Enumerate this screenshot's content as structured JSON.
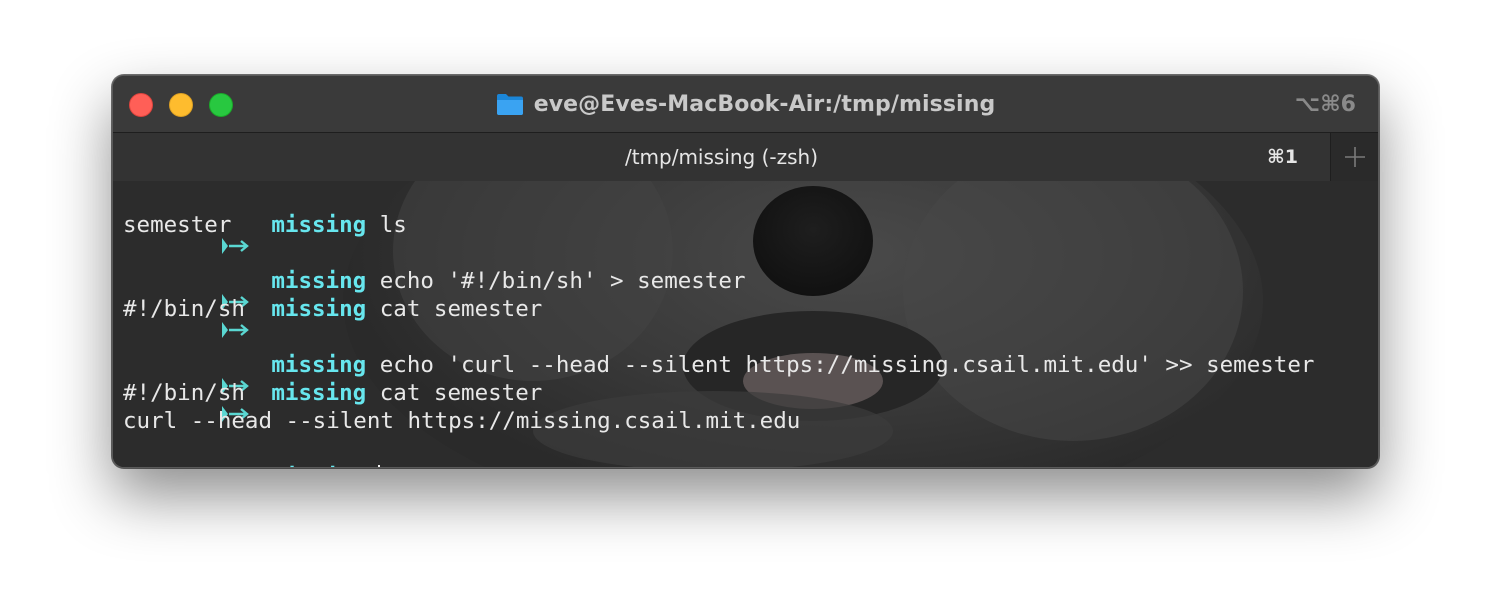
{
  "window": {
    "title": "eve@Eves-MacBook-Air:/tmp/missing",
    "title_shortcut": "⌥⌘6",
    "folder_icon": "folder-icon",
    "colors": {
      "close": "#ff5f57",
      "minimize": "#febc2e",
      "zoom": "#28c840"
    }
  },
  "tab": {
    "label": "/tmp/missing (-zsh)",
    "shortcut": "⌘1",
    "new_tab_icon": "plus-icon"
  },
  "terminal": {
    "colors": {
      "prompt_arrow": "#5ad7d2",
      "prompt_dir": "#67e6ee",
      "text": "#e8e8e8"
    },
    "lines": [
      {
        "type": "prompt",
        "dir": "missing",
        "command": "ls"
      },
      {
        "type": "output",
        "text": "semester"
      },
      {
        "type": "prompt",
        "dir": "missing",
        "command": "echo '#!/bin/sh' > semester"
      },
      {
        "type": "prompt",
        "dir": "missing",
        "command": "cat semester"
      },
      {
        "type": "output",
        "text": "#!/bin/sh"
      },
      {
        "type": "prompt",
        "dir": "missing",
        "command": "echo 'curl --head --silent https://missing.csail.mit.edu' >> semester"
      },
      {
        "type": "prompt",
        "dir": "missing",
        "command": "cat semester"
      },
      {
        "type": "output",
        "text": "#!/bin/sh"
      },
      {
        "type": "output",
        "text": "curl --head --silent https://missing.csail.mit.edu"
      },
      {
        "type": "prompt",
        "dir": "missing",
        "command": ""
      }
    ]
  }
}
